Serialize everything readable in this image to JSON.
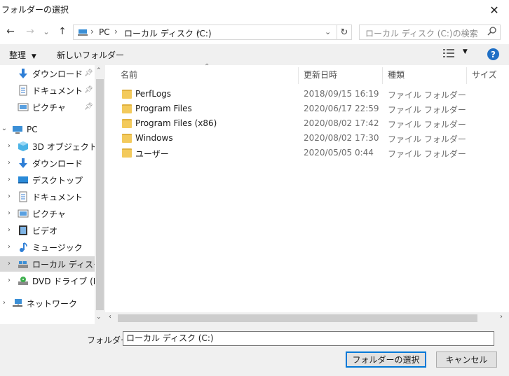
{
  "window": {
    "title": "フォルダーの選択",
    "close_glyph": "✕"
  },
  "nav": {
    "back": "←",
    "forward": "→",
    "recent": "⌄",
    "up": "↑",
    "breadcrumb": [
      "PC",
      "ローカル ディスク (C:)"
    ],
    "breadcrumb_sep": "›",
    "refresh": "↻",
    "search_placeholder": "ローカル ディスク (C:)の検索"
  },
  "toolbar": {
    "organize": "整理",
    "new_folder": "新しいフォルダー",
    "help": "?"
  },
  "sidebar": {
    "quick": [
      {
        "label": "ダウンロード",
        "icon": "download-icon"
      },
      {
        "label": "ドキュメント",
        "icon": "document-icon"
      },
      {
        "label": "ピクチャ",
        "icon": "picture-icon"
      }
    ],
    "pc_label": "PC",
    "pc_items": [
      {
        "label": "3D オブジェクト",
        "icon": "cube-3d-icon"
      },
      {
        "label": "ダウンロード",
        "icon": "download-icon"
      },
      {
        "label": "デスクトップ",
        "icon": "desktop-icon"
      },
      {
        "label": "ドキュメント",
        "icon": "document-icon"
      },
      {
        "label": "ピクチャ",
        "icon": "picture-icon"
      },
      {
        "label": "ビデオ",
        "icon": "video-icon"
      },
      {
        "label": "ミュージック",
        "icon": "music-icon"
      },
      {
        "label": "ローカル ディスク (C",
        "icon": "drive-icon"
      },
      {
        "label": "DVD ドライブ (D:)",
        "icon": "dvd-icon"
      }
    ],
    "network_label": "ネットワーク"
  },
  "columns": {
    "name": "名前",
    "modified": "更新日時",
    "type": "種類",
    "size": "サイズ"
  },
  "files": [
    {
      "name": "PerfLogs",
      "modified": "2018/09/15 16:19",
      "type": "ファイル フォルダー"
    },
    {
      "name": "Program Files",
      "modified": "2020/06/17 22:59",
      "type": "ファイル フォルダー"
    },
    {
      "name": "Program Files (x86)",
      "modified": "2020/08/02 17:42",
      "type": "ファイル フォルダー"
    },
    {
      "name": "Windows",
      "modified": "2020/08/02 17:30",
      "type": "ファイル フォルダー"
    },
    {
      "name": "ユーザー",
      "modified": "2020/05/05 0:44",
      "type": "ファイル フォルダー"
    }
  ],
  "footer": {
    "folder_label": "フォルダー:",
    "folder_value": "ローカル ディスク (C:)",
    "select_button": "フォルダーの選択",
    "cancel_button": "キャンセル"
  },
  "colors": {
    "accent": "#0078d7",
    "folder": "#f3ca5c",
    "selected_bg": "#cce8ff"
  }
}
